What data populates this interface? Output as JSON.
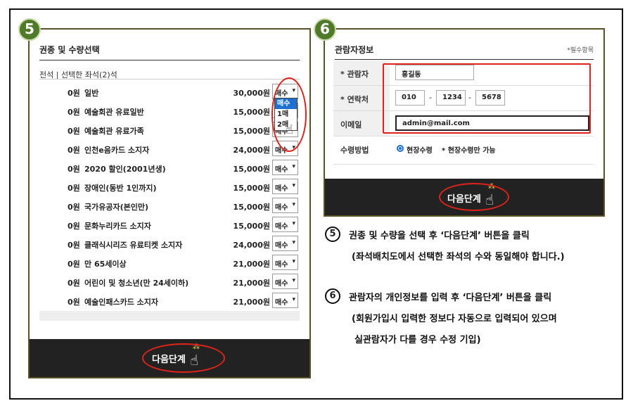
{
  "steps": {
    "five": "5",
    "six": "6"
  },
  "ticket_panel": {
    "title": "권종 및 수량선택",
    "seat_summary": "전석 | 선택한 좌석(2)석",
    "tickets": [
      {
        "price0": "0원",
        "name": "일반",
        "price": "30,000원",
        "qty": "매수"
      },
      {
        "price0": "0원",
        "name": "예술회관 유료일반",
        "price": "15,000원",
        "qty": "매수"
      },
      {
        "price0": "0원",
        "name": "예술회관 유료가족",
        "price": "15,000원",
        "qty": "매수"
      },
      {
        "price0": "0원",
        "name": "인천e음카드 소지자",
        "price": "24,000원",
        "qty": "매수"
      },
      {
        "price0": "0원",
        "name": "2020 할인(2001년생)",
        "price": "15,000원",
        "qty": "매수"
      },
      {
        "price0": "0원",
        "name": "장애인(동반 1인까지)",
        "price": "15,000원",
        "qty": "매수"
      },
      {
        "price0": "0원",
        "name": "국가유공자(본인만)",
        "price": "15,000원",
        "qty": "매수"
      },
      {
        "price0": "0원",
        "name": "문화누리카드 소지자",
        "price": "15,000원",
        "qty": "매수"
      },
      {
        "price0": "0원",
        "name": "클래식시리즈 유료티켓 소지자",
        "price": "24,000원",
        "qty": "매수"
      },
      {
        "price0": "0원",
        "name": "만 65세이상",
        "price": "21,000원",
        "qty": "매수"
      },
      {
        "price0": "0원",
        "name": "어린이 및 청소년(만 24세이하)",
        "price": "21,000원",
        "qty": "매수"
      },
      {
        "price0": "0원",
        "name": "예술인패스카드 소지자",
        "price": "21,000원",
        "qty": "매수"
      }
    ],
    "dropdown_options": [
      "매수",
      "1매",
      "2매"
    ],
    "next_button": "다음단계"
  },
  "viewer_panel": {
    "title": "관람자정보",
    "required_note": "*필수항목",
    "name_label": "* 관람자",
    "name_value": "홍길동",
    "phone_label": "* 연락처",
    "phone1": "010",
    "phone2": "1234",
    "phone3": "5678",
    "phone_sep": "-",
    "email_label": "이메일",
    "email_value": "admin@mail.com",
    "pickup_label": "수령방법",
    "pickup_option": "현장수령",
    "pickup_note": "* 현장수령만 가능",
    "next_button": "다음단계"
  },
  "instructions": {
    "step5_line1": "권종 및 수량을 선택 후 ‘다음단계’ 버튼을 클릭",
    "step5_line2": "(좌석배치도에서 선택한 좌석의 수와 동일해야 합니다.)",
    "step6_line1": "관람자의 개인정보를 입력 후 ‘다음단계’ 버튼을 클릭",
    "step6_line2": "(회원가입시 입력한 정보다 자동으로 입력되어 있으며",
    "step6_line3": "실관람자가 다를 경우 수정 기입)"
  },
  "colors": {
    "badge_green": "#4f7a2a",
    "highlight_red": "#e0221a",
    "select_blue": "#1e6fd0",
    "bar_dark": "#222222"
  }
}
